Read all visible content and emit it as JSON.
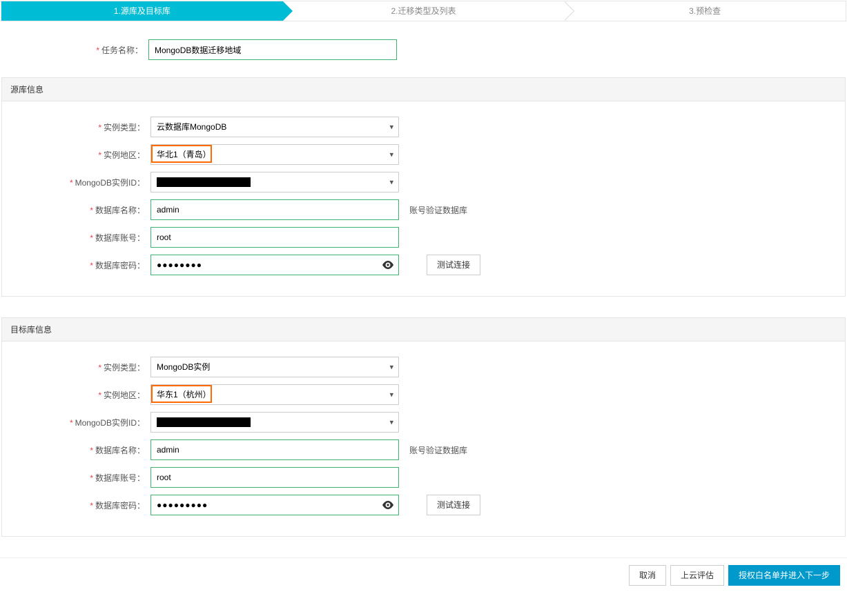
{
  "steps": {
    "s1": "1.源库及目标库",
    "s2": "2.迁移类型及列表",
    "s3": "3.预检查"
  },
  "labels": {
    "task_name": "任务名称：",
    "instance_type": "实例类型：",
    "instance_region": "实例地区：",
    "mongodb_instance_id": "MongoDB实例ID：",
    "db_name": "数据库名称：",
    "db_account": "数据库账号：",
    "db_password": "数据库密码："
  },
  "section_titles": {
    "source": "源库信息",
    "target": "目标库信息"
  },
  "values": {
    "task_name": "MongoDB数据迁移地域",
    "source": {
      "instance_type": "云数据库MongoDB",
      "instance_region": "华北1（青岛）",
      "instance_id_placeholder": "████████████████",
      "db_name": "admin",
      "db_account": "root",
      "db_password_dots": "●●●●●●●●"
    },
    "target": {
      "instance_type": "MongoDB实例",
      "instance_region": "华东1（杭州）",
      "instance_id_placeholder": "████████████████",
      "db_name": "admin",
      "db_account": "root",
      "db_password_dots": "●●●●●●●●●"
    }
  },
  "hints": {
    "auth_db": "账号验证数据库"
  },
  "buttons": {
    "test_conn": "测试连接",
    "cancel": "取消",
    "cloud_eval": "上云评估",
    "next": "授权白名单并进入下一步"
  },
  "highlight_widths": {
    "source_region": "88px",
    "target_region": "88px"
  }
}
